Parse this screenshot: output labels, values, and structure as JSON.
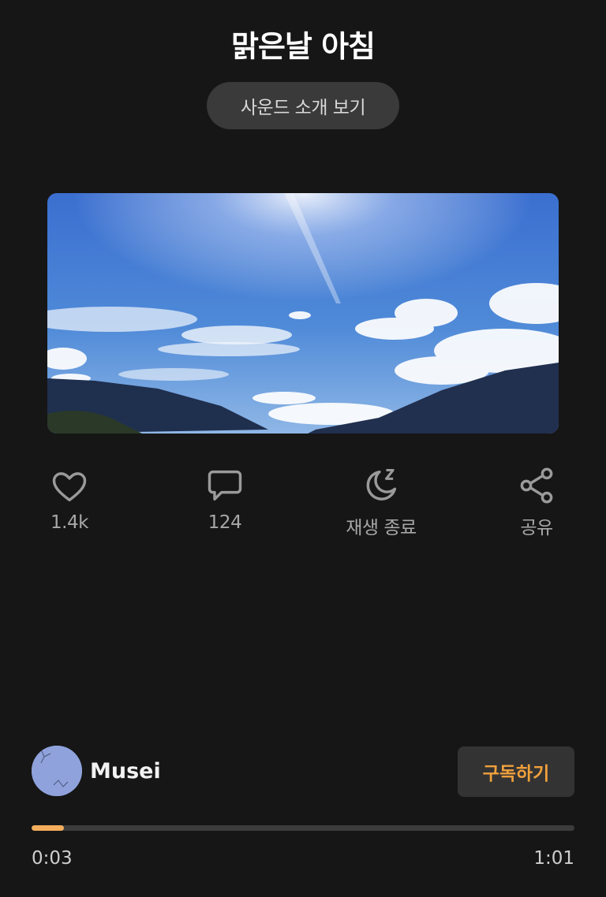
{
  "title": "맑은날 아침",
  "intro_button": "사운드 소개 보기",
  "actions": {
    "like": {
      "label": "1.4k",
      "icon": "heart-icon"
    },
    "comment": {
      "label": "124",
      "icon": "comment-icon"
    },
    "sleep_timer": {
      "label": "재생 종료",
      "icon": "moon-icon"
    },
    "share": {
      "label": "공유",
      "icon": "share-icon"
    }
  },
  "creator": {
    "name": "Musei"
  },
  "subscribe_button": "구독하기",
  "player": {
    "current_time": "0:03",
    "total_time": "1:01",
    "progress": 0.06,
    "accent_color": "#f3ad5c"
  }
}
